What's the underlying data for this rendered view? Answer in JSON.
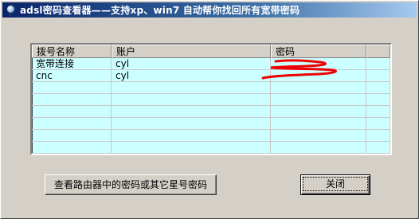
{
  "window": {
    "title": "adsl密码查看器——支持xp、win7 自动帮你找回所有宽带密码"
  },
  "listview": {
    "columns": [
      "拨号名称",
      "账户",
      "密码",
      ""
    ],
    "rows": [
      {
        "name": "宽带连接",
        "account": "cyl",
        "password": ""
      },
      {
        "name": "cnc",
        "account": "cyl",
        "password": ""
      }
    ],
    "password_redaction_color": "#ee0000"
  },
  "buttons": {
    "reveal_label": "查看路由器中的密码或其它星号密码",
    "close_label": "关闭"
  }
}
